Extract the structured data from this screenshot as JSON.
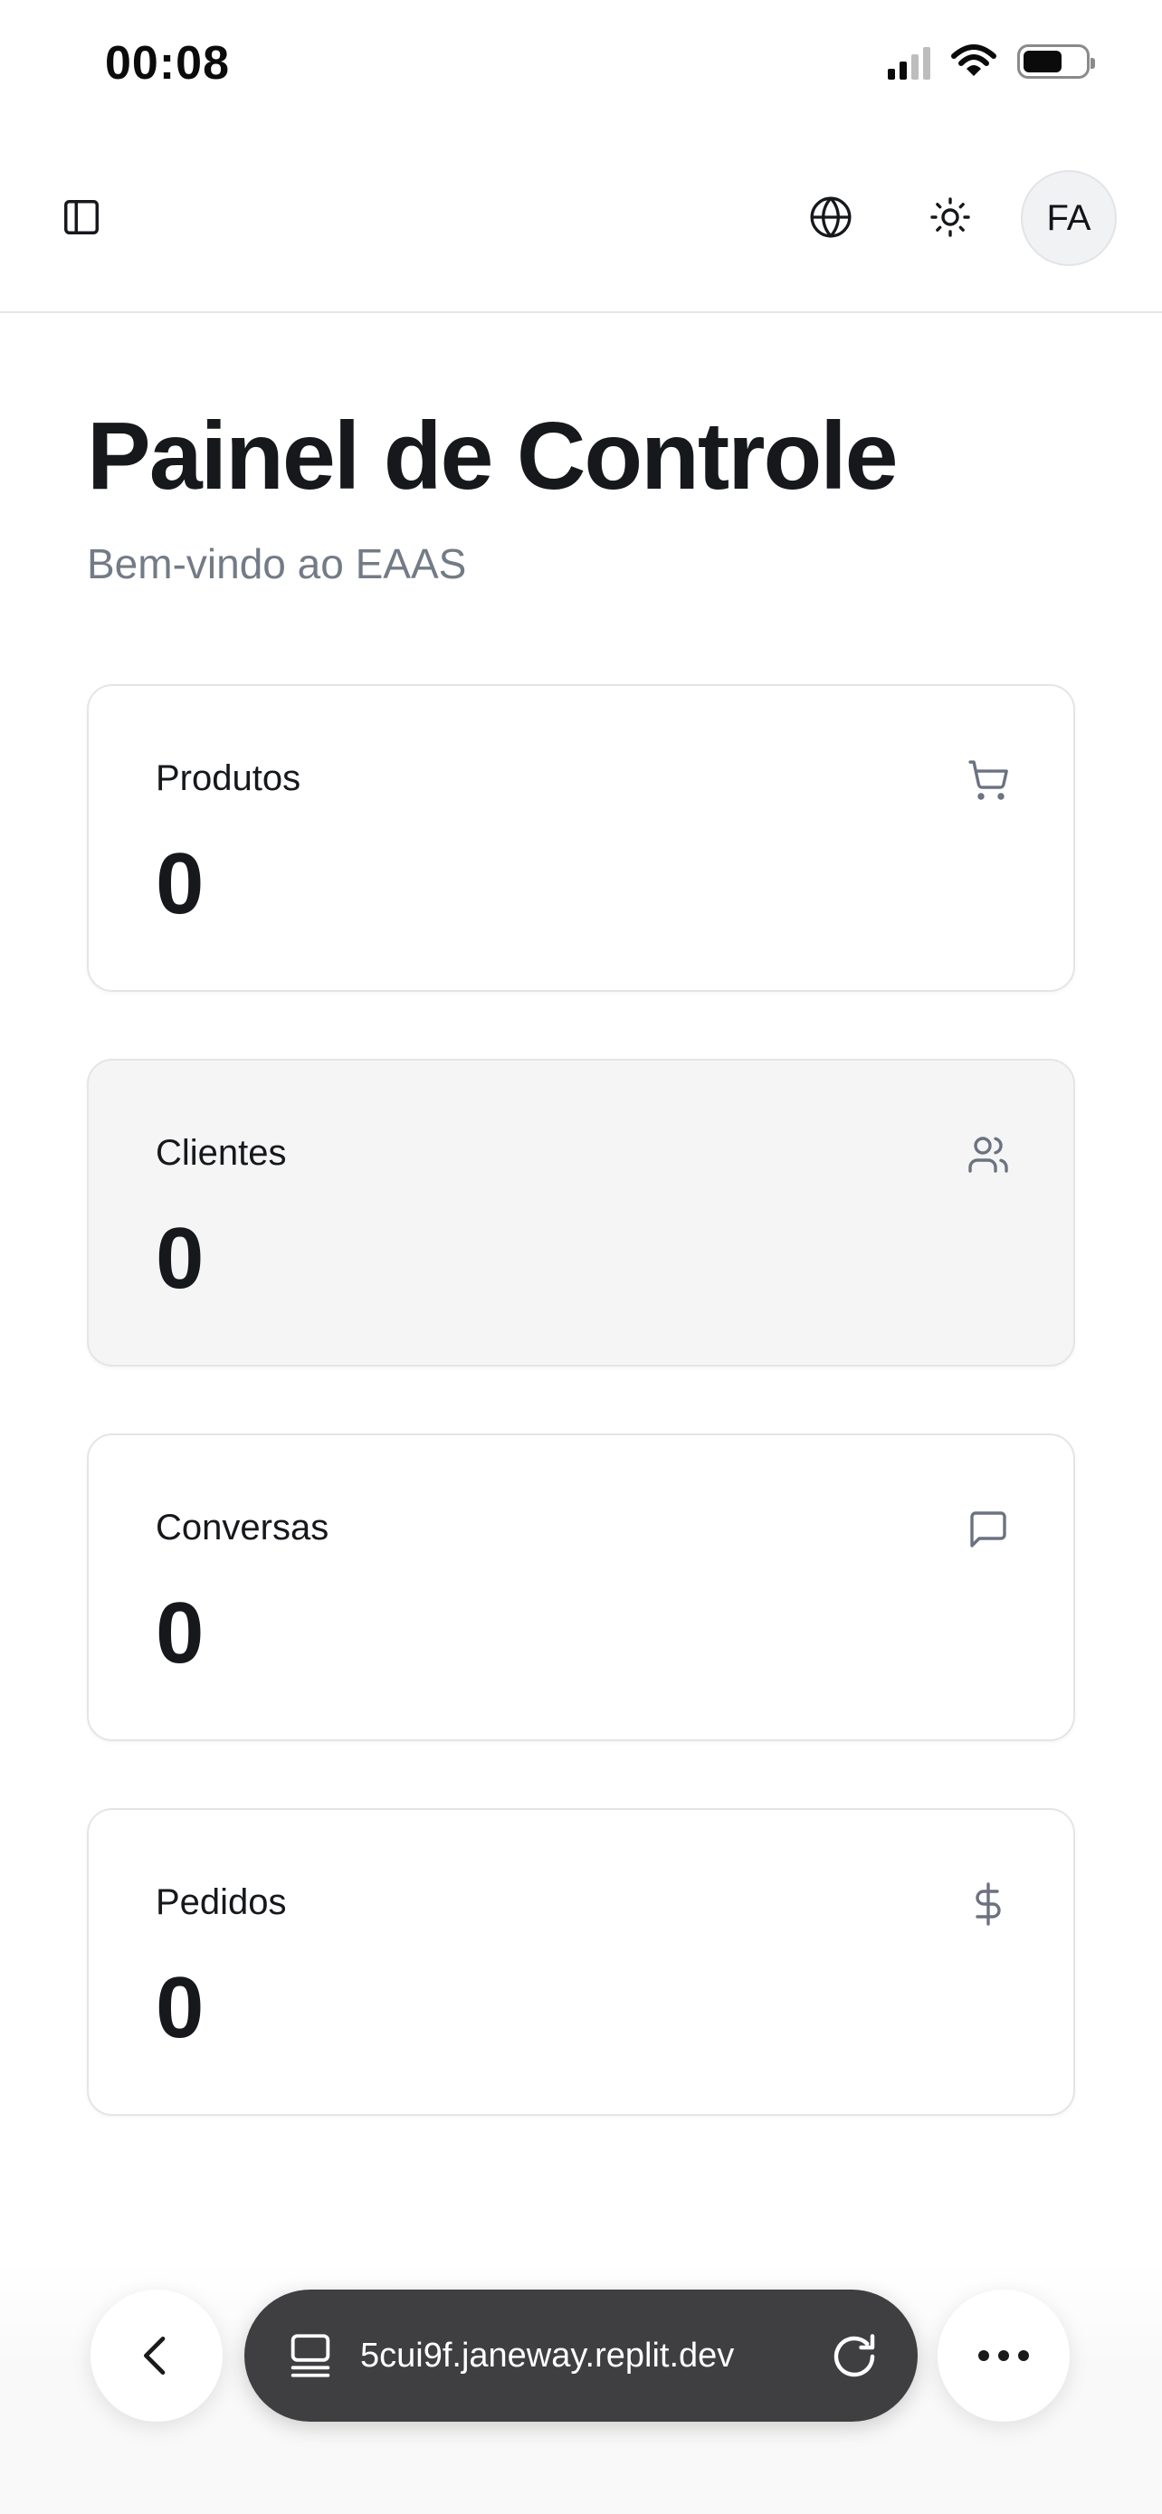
{
  "status_bar": {
    "time": "00:08"
  },
  "header": {
    "sidebar_icon": "sidebar-panel-icon",
    "language_icon": "globe-icon",
    "theme_icon": "sun-icon",
    "avatar_initials": "FA"
  },
  "main": {
    "title": "Painel de Controle",
    "subtitle": "Bem-vindo ao EAAS",
    "cards": [
      {
        "label": "Produtos",
        "value": "0",
        "icon": "shopping-cart-icon"
      },
      {
        "label": "Clientes",
        "value": "0",
        "icon": "users-icon"
      },
      {
        "label": "Conversas",
        "value": "0",
        "icon": "message-square-icon"
      },
      {
        "label": "Pedidos",
        "value": "0",
        "icon": "dollar-sign-icon"
      }
    ]
  },
  "browser": {
    "url": "5cui9f.janeway.replit.dev",
    "back_icon": "chevron-left-icon",
    "tabs_icon": "tabs-icon",
    "reload_icon": "reload-icon",
    "more_icon": "more-horizontal-icon"
  },
  "colors": {
    "text_primary": "#16181c",
    "text_muted": "#737b86",
    "card_border": "#e4e5e8",
    "card_hover_bg": "#f5f5f6",
    "url_pill_bg": "#3f3f41"
  }
}
